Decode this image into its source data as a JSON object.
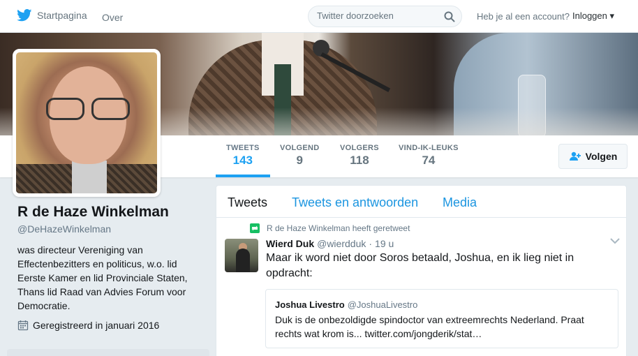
{
  "nav": {
    "home": "Startpagina",
    "about": "Over",
    "search_placeholder": "Twitter doorzoeken",
    "account_prompt": "Heb je al een account?",
    "login": "Inloggen"
  },
  "stats": [
    {
      "label": "TWEETS",
      "value": "143"
    },
    {
      "label": "VOLGEND",
      "value": "9"
    },
    {
      "label": "VOLGERS",
      "value": "118"
    },
    {
      "label": "VIND-IK-LEUKS",
      "value": "74"
    }
  ],
  "follow_label": "Volgen",
  "profile": {
    "name": "R de Haze Winkelman",
    "handle": "@DeHazeWinkelman",
    "bio": "was directeur Vereniging van Effectenbezitters en politicus, w.o. lid Eerste Kamer en lid Provinciale Staten, Thans lid Raad van Advies Forum voor Democratie.",
    "joined": "Geregistreerd in januari 2016"
  },
  "tabs": [
    "Tweets",
    "Tweets en antwoorden",
    "Media"
  ],
  "tweet": {
    "context": "R de Haze Winkelman heeft geretweet",
    "name": "Wierd Duk",
    "handle": "@wierdduk",
    "time": "19 u",
    "text": "Maar ik word niet door Soros betaald, Joshua, en ik lieg niet in opdracht:",
    "quote": {
      "name": "Joshua Livestro",
      "handle": "@JoshuaLivestro",
      "text": "Duk is de onbezoldigde spindoctor van extreemrechts Nederland. Praat rechts wat krom is... twitter.com/jongderik/stat…"
    }
  },
  "colors": {
    "accent": "#1da1f2",
    "retweet": "#17bf63",
    "background": "#e6ecf0"
  }
}
